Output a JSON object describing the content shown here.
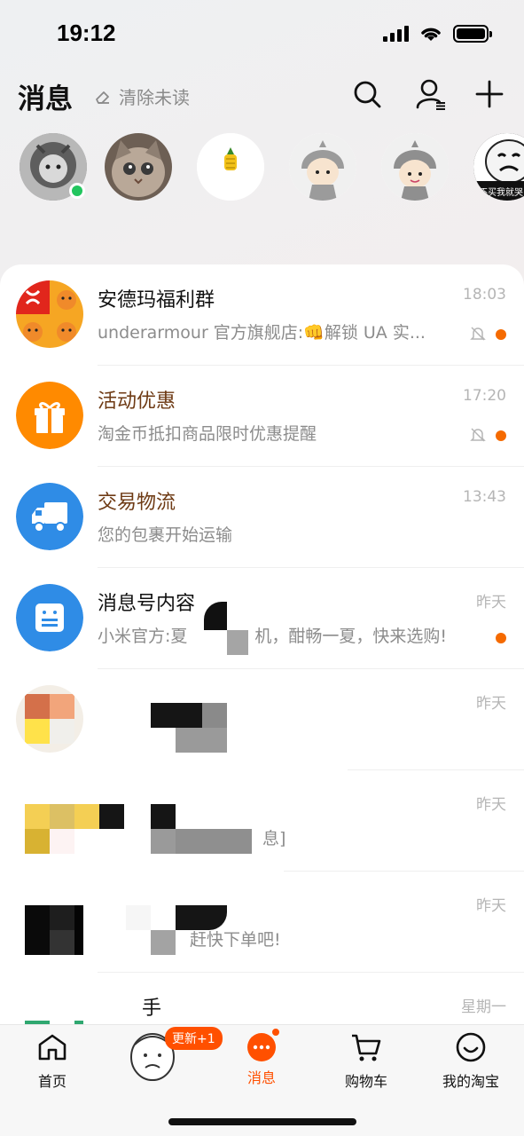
{
  "status_bar": {
    "time": "19:12"
  },
  "header": {
    "title": "消息",
    "clear_unread": "清除未读"
  },
  "stories": [
    {
      "name": "lion-cat-avatar",
      "online": true
    },
    {
      "name": "cat-avatar",
      "online": false
    },
    {
      "name": "pineapple-avatar",
      "online": false
    },
    {
      "name": "cartoon-boy-avatar-1",
      "online": false
    },
    {
      "name": "cartoon-boy-avatar-2",
      "online": false
    },
    {
      "name": "meme-avatar",
      "online": false,
      "caption": "不买我就哭"
    }
  ],
  "conversations": [
    {
      "name": "安德玛福利群",
      "preview": "underarmour 官方旗舰店:👊解锁 UA 实...",
      "time": "18:03",
      "muted": true,
      "unread": true,
      "name_style": "normal"
    },
    {
      "name": "活动优惠",
      "preview": "淘金币抵扣商品限时优惠提醒",
      "time": "17:20",
      "muted": true,
      "unread": true,
      "name_style": "brown"
    },
    {
      "name": "交易物流",
      "preview": "您的包裹开始运输",
      "time": "13:43",
      "muted": false,
      "unread": false,
      "name_style": "brown"
    },
    {
      "name": "消息号内容",
      "preview": "小米官方:夏　　　　机，酣畅一夏，快来选购!",
      "time": "昨天",
      "muted": false,
      "unread": true,
      "name_style": "normal"
    },
    {
      "name": "",
      "preview": "",
      "time": "昨天",
      "muted": false,
      "unread": false,
      "name_style": "normal"
    },
    {
      "name": "",
      "preview": "息]",
      "time": "昨天",
      "muted": false,
      "unread": false,
      "name_style": "normal"
    },
    {
      "name": "",
      "preview": "赶快下单吧!",
      "time": "昨天",
      "muted": false,
      "unread": false,
      "name_style": "normal"
    },
    {
      "name": "手",
      "preview": "",
      "time": "星期一",
      "muted": false,
      "unread": false,
      "name_style": "normal"
    }
  ],
  "tabbar": {
    "home": "首页",
    "update_badge": "更新+1",
    "messages": "消息",
    "cart": "购物车",
    "mine": "我的淘宝"
  },
  "colors": {
    "accent": "#ff5000",
    "unread_dot": "#f56a00",
    "gift_orange": "#ff8a00",
    "blue_icon": "#2f8ce6",
    "online": "#22c55e"
  }
}
